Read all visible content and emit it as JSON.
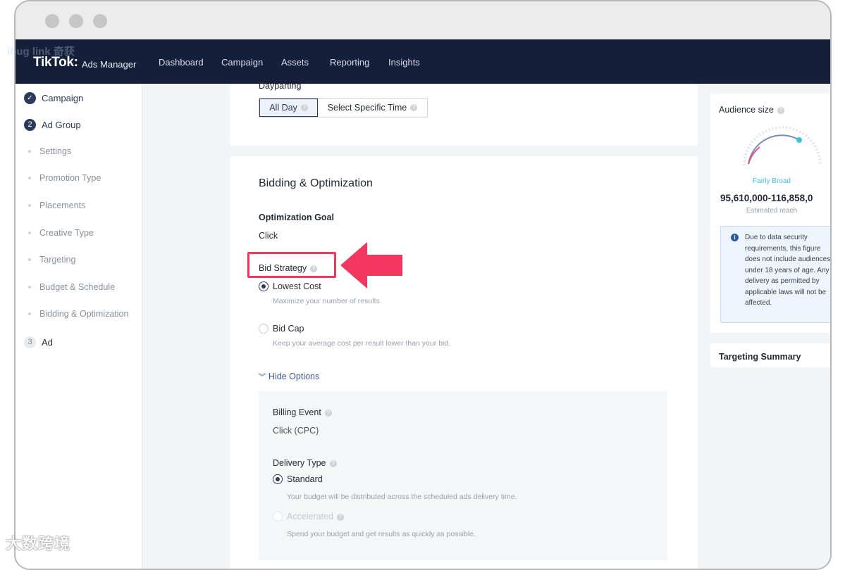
{
  "header": {
    "logo": "TikTok:",
    "logo_sub": "Ads Manager",
    "nav": [
      "Dashboard",
      "Campaign",
      "Assets",
      "Reporting",
      "Insights"
    ]
  },
  "sidebar": {
    "steps": [
      {
        "label": "Campaign",
        "marker": "✓"
      },
      {
        "label": "Ad Group",
        "marker": "2"
      },
      {
        "label": "Ad",
        "marker": "3"
      }
    ],
    "sub_items": [
      "Settings",
      "Promotion Type",
      "Placements",
      "Creative Type",
      "Targeting",
      "Budget & Schedule",
      "Bidding & Optimization"
    ]
  },
  "dayparting": {
    "label": "Dayparting",
    "options": [
      "All Day",
      "Select Specific Time"
    ],
    "selected": "All Day"
  },
  "bidding": {
    "title": "Bidding & Optimization",
    "goal_label": "Optimization Goal",
    "goal_value": "Click",
    "strategy_label": "Bid Strategy",
    "options": [
      {
        "label": "Lowest Cost",
        "desc": "Maximize your number of results",
        "selected": true
      },
      {
        "label": "Bid Cap",
        "desc": "Keep your average cost per result lower than your bid.",
        "selected": false
      }
    ],
    "hide_options": "Hide Options",
    "billing_label": "Billing Event",
    "billing_value": "Click (CPC)",
    "delivery_label": "Delivery Type",
    "delivery_options": [
      {
        "label": "Standard",
        "desc": "Your budget will be distributed across the scheduled ads delivery time.",
        "selected": true
      },
      {
        "label": "Accelerated",
        "desc": "Spend your budget and get results as quickly as possible.",
        "selected": false
      }
    ]
  },
  "audience": {
    "title": "Audience size",
    "status": "Fairly Broad",
    "range": "95,610,000-116,858,0",
    "range_caption": "Estimated reach",
    "note": "Due to data security requirements, this figure does not include audiences under 18 years of age. Any delivery as permitted by applicable laws will not be affected.",
    "summary_title": "Targeting Summary"
  },
  "watermark": {
    "text": "大数跨境",
    "logo_text": "ibug link 奇获"
  },
  "colors": {
    "header_bg": "#14203a",
    "accent": "#2b3a5b",
    "highlight_red": "#f2365d",
    "gauge_teal": "#3dc4d6"
  }
}
